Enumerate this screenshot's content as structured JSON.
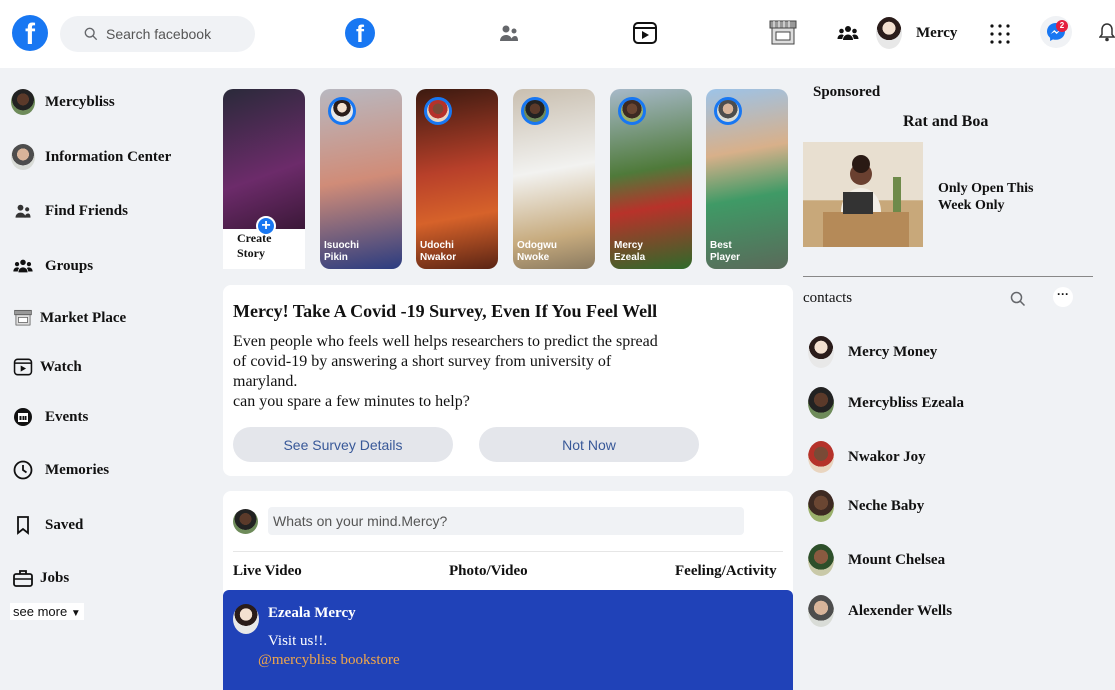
{
  "topbar": {
    "logo": "f",
    "search_placeholder": "Search facebook",
    "user_name": "Mercy",
    "notification_count": "2",
    "icons": [
      "facebook-icon",
      "friends-icon",
      "watch-icon",
      "marketplace-icon",
      "groups-icon",
      "menu-grid-icon",
      "messenger-icon",
      "bell-icon"
    ]
  },
  "sidebar": {
    "items": [
      {
        "label": "Mercybliss",
        "icon": "avatar"
      },
      {
        "label": "Information Center",
        "icon": "avatar"
      },
      {
        "label": "Find Friends",
        "icon": "friends-icon"
      },
      {
        "label": "Groups",
        "icon": "groups-icon"
      },
      {
        "label": "Market Place",
        "icon": "marketplace-icon"
      },
      {
        "label": "Watch",
        "icon": "watch-icon"
      },
      {
        "label": "Events",
        "icon": "calendar-icon"
      },
      {
        "label": "Memories",
        "icon": "clock-icon"
      },
      {
        "label": "Saved",
        "icon": "bookmark-icon"
      },
      {
        "label": "Jobs",
        "icon": "briefcase-icon"
      }
    ],
    "see_more": "see more"
  },
  "stories": {
    "create_line1": "Create",
    "create_line2": "Story",
    "items": [
      {
        "line1": "Isuochi",
        "line2": "Pikin"
      },
      {
        "line1": "Udochi",
        "line2": "Nwakor"
      },
      {
        "line1": "Odogwu",
        "line2": "Nwoke"
      },
      {
        "line1": "Mercy",
        "line2": "Ezeala"
      },
      {
        "line1": "Best",
        "line2": "Player"
      }
    ]
  },
  "survey": {
    "title": "Mercy! Take A Covid -19 Survey, Even If You Feel Well",
    "body_line1": "Even people who feels well helps researchers to predict the spread",
    "body_line2": "of covid-19 by answering a short survey from university of",
    "body_line3": "maryland.",
    "body_line4": "can you spare a few minutes to help?",
    "primary_button": "See Survey Details",
    "secondary_button": "Not Now"
  },
  "composer": {
    "placeholder": "Whats on your mind.Mercy?",
    "options": [
      "Live Video",
      "Photo/Video",
      "Feeling/Activity"
    ]
  },
  "post": {
    "author": "Ezeala Mercy",
    "text": "Visit us!!.",
    "link": "@mercybliss bookstore"
  },
  "right": {
    "sponsored": "Sponsored",
    "ad_title": "Rat and Boa",
    "ad_text": "Only Open This Week Only",
    "contacts_heading": "contacts",
    "more_label": "···",
    "contacts": [
      "Mercy Money",
      "Mercybliss Ezeala",
      "Nwakor Joy",
      "Neche Baby",
      "Mount Chelsea",
      "Alexender Wells"
    ]
  }
}
